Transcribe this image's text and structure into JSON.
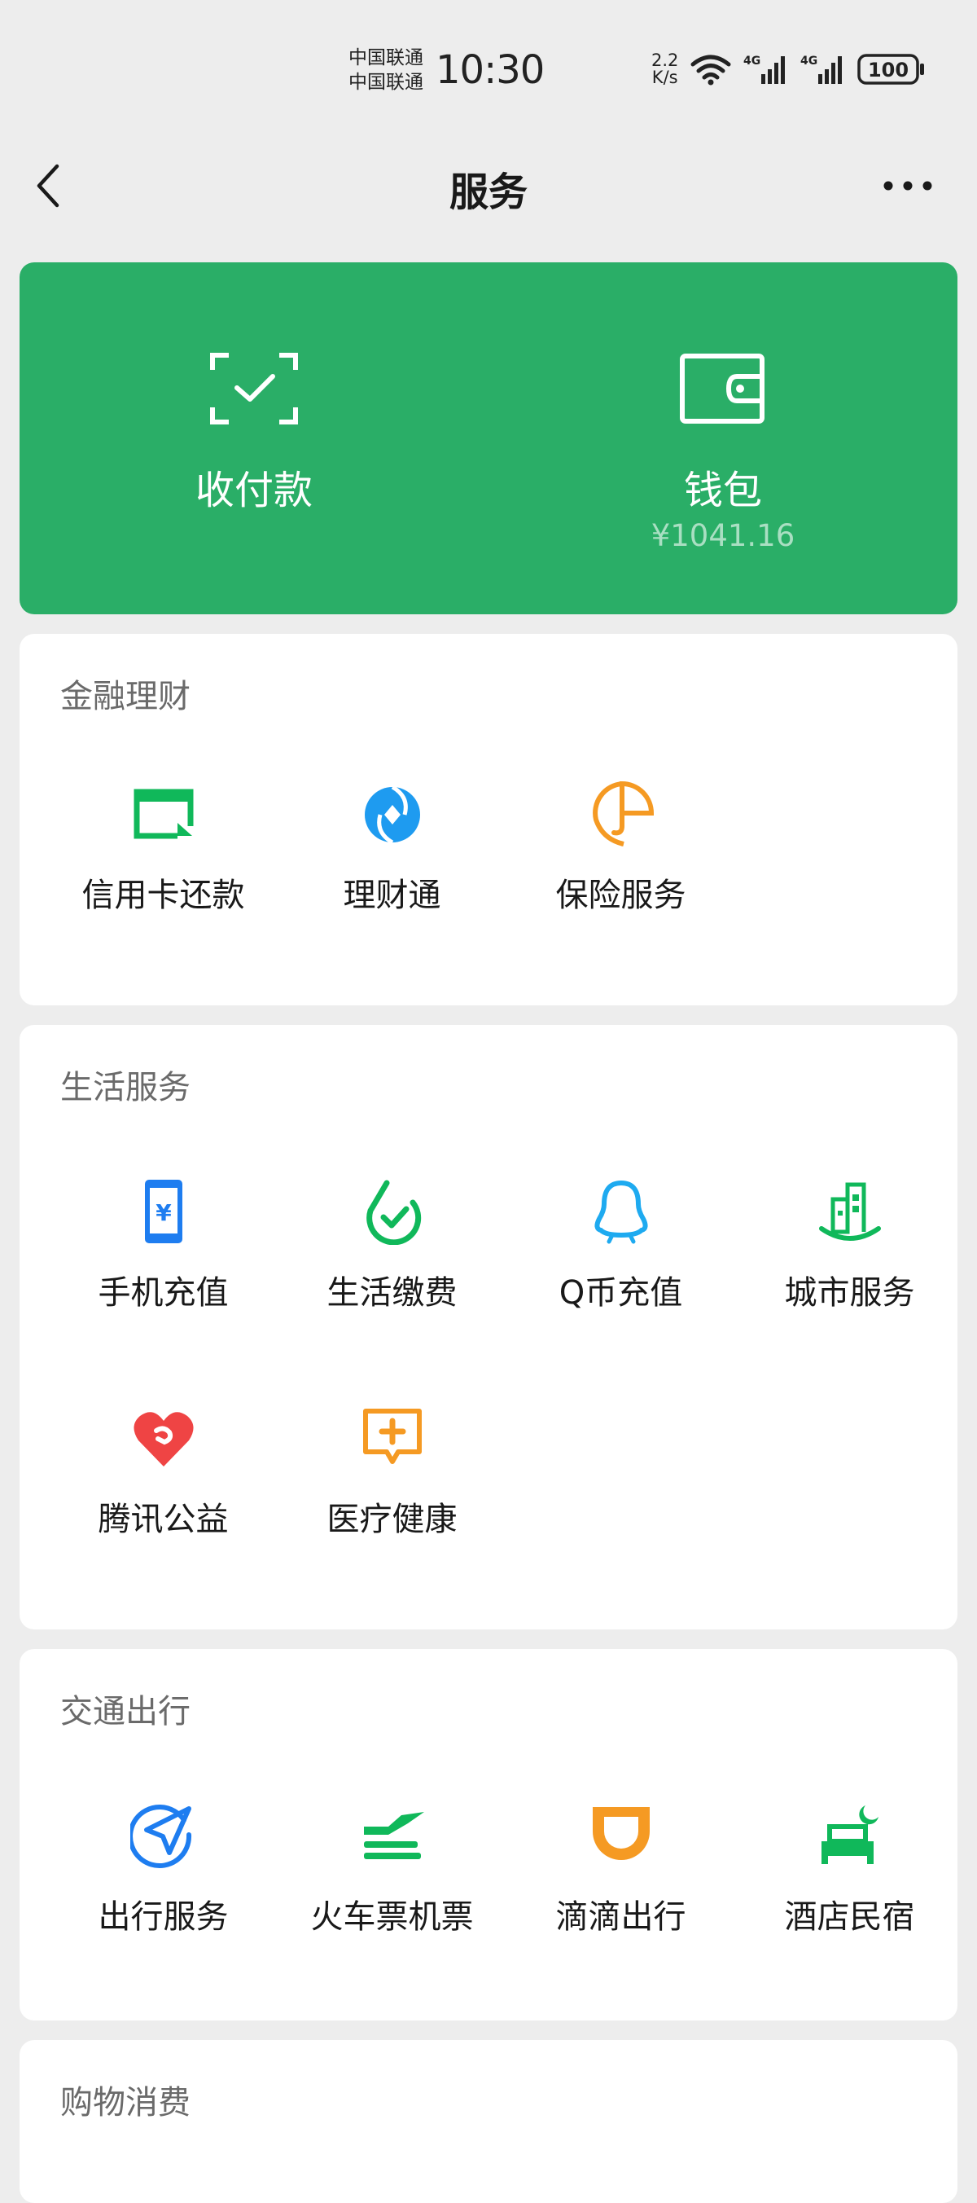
{
  "status_bar": {
    "carrier_1": "中国联通",
    "carrier_2": "中国联通",
    "time": "10:30",
    "net_speed_value": "2.2",
    "net_speed_unit": "K/s",
    "network_1": "4G",
    "network_2": "4G",
    "battery": "100"
  },
  "nav": {
    "title": "服务",
    "back_icon": "chevron-left-icon",
    "more_icon": "more-dots-icon"
  },
  "wallet_card": {
    "color": "#2aae67",
    "pay": {
      "label": "收付款",
      "icon": "scan-check-icon"
    },
    "wallet": {
      "label": "钱包",
      "balance": "¥1041.16",
      "icon": "wallet-icon"
    }
  },
  "sections": [
    {
      "title": "金融理财",
      "items": [
        {
          "label": "信用卡还款",
          "icon": "credit-card-icon",
          "color": "#10b85a"
        },
        {
          "label": "理财通",
          "icon": "wealth-icon",
          "color": "#1e9bf0"
        },
        {
          "label": "保险服务",
          "icon": "umbrella-icon",
          "color": "#f59a23"
        }
      ]
    },
    {
      "title": "生活服务",
      "items": [
        {
          "label": "手机充值",
          "icon": "phone-icon",
          "color": "#1e7df0"
        },
        {
          "label": "生活缴费",
          "icon": "check-circle-icon",
          "color": "#10b85a"
        },
        {
          "label": "Q币充值",
          "icon": "penguin-icon",
          "color": "#1eaaf0"
        },
        {
          "label": "城市服务",
          "icon": "city-icon",
          "color": "#10b85a"
        },
        {
          "label": "腾讯公益",
          "icon": "heart-icon",
          "color": "#ef4444"
        },
        {
          "label": "医疗健康",
          "icon": "medical-icon",
          "color": "#f59a23"
        }
      ]
    },
    {
      "title": "交通出行",
      "items": [
        {
          "label": "出行服务",
          "icon": "navigation-icon",
          "color": "#1e7df0"
        },
        {
          "label": "火车票机票",
          "icon": "train-plane-icon",
          "color": "#10b85a"
        },
        {
          "label": "滴滴出行",
          "icon": "didi-icon",
          "color": "#f59a23"
        },
        {
          "label": "酒店民宿",
          "icon": "hotel-bed-icon",
          "color": "#10b85a"
        }
      ]
    },
    {
      "title": "购物消费",
      "items": []
    }
  ]
}
